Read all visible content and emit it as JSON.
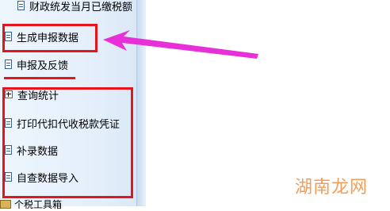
{
  "nav": {
    "items": [
      {
        "label": "财政统发当月已缴税额"
      },
      {
        "label": "生成申报数据"
      },
      {
        "label": "申报及反馈"
      },
      {
        "label": "查询统计"
      },
      {
        "label": "打印代扣代收税款凭证"
      },
      {
        "label": "补录数据"
      },
      {
        "label": "自查数据导入"
      }
    ],
    "partial_bottom_label": "个税工具箱"
  },
  "annotation_colors": {
    "highlight": "#e8141b",
    "arrow": "#e830d8"
  },
  "watermark": "湖南龙网"
}
